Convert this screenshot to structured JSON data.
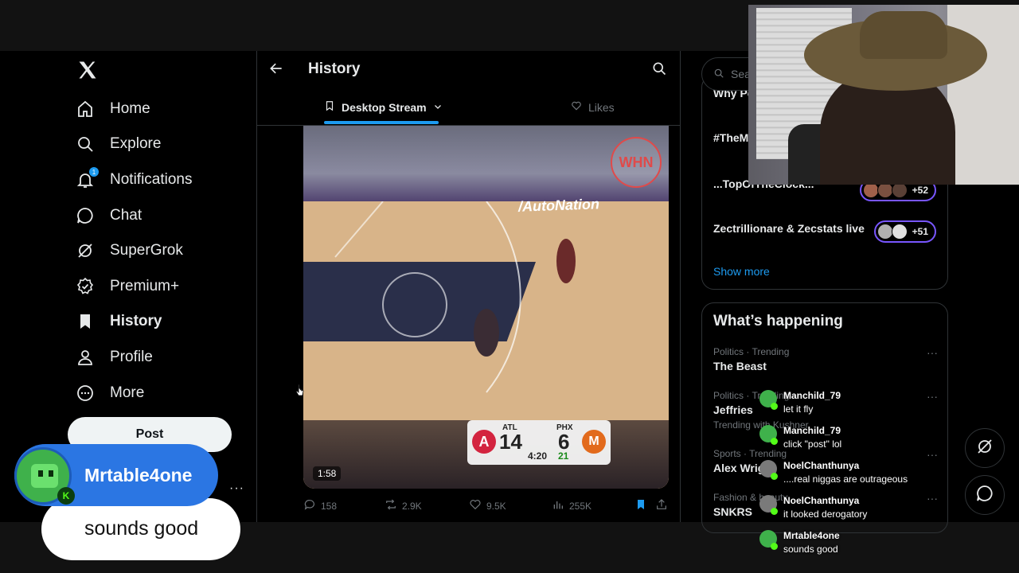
{
  "nav": {
    "items": [
      {
        "label": "Home",
        "icon": "home-icon"
      },
      {
        "label": "Explore",
        "icon": "search-icon"
      },
      {
        "label": "Notifications",
        "icon": "bell-icon",
        "badge": "1"
      },
      {
        "label": "Chat",
        "icon": "chat-bubble-icon"
      },
      {
        "label": "SuperGrok",
        "icon": "grok-icon"
      },
      {
        "label": "Premium+",
        "icon": "verified-icon"
      },
      {
        "label": "History",
        "icon": "bookmark-icon",
        "active": true
      },
      {
        "label": "Profile",
        "icon": "person-icon"
      },
      {
        "label": "More",
        "icon": "more-circle-icon"
      }
    ],
    "post_label": "Post",
    "more_dots": "···"
  },
  "header": {
    "title": "History",
    "tabs": [
      {
        "label": "Desktop Stream",
        "active": true
      },
      {
        "label": "Likes",
        "active": false
      }
    ]
  },
  "video": {
    "duration": "1:58",
    "banner": "/AutoNation",
    "watermark": "WHN",
    "score": {
      "away_team": "ATL",
      "away_score": "14",
      "home_team": "PHX",
      "home_score": "6",
      "clock": "4:20",
      "shot_clock": "21",
      "away_logo": "A",
      "home_logo": "M"
    }
  },
  "actions": {
    "replies": "158",
    "reposts": "2.9K",
    "likes": "9.5K",
    "views": "255K"
  },
  "right": {
    "search_placeholder": "Search",
    "live": [
      {
        "title": "Why People",
        "count": ""
      },
      {
        "title": "#TheM mornin",
        "count": ""
      },
      {
        "title": "...TopOfTheClock...",
        "count": "+52"
      },
      {
        "title": "Zectrillionare & Zecstats live",
        "count": "+51"
      }
    ],
    "show_more": "Show more",
    "happening_title": "What’s happening",
    "trends": [
      {
        "meta": "Politics · Trending",
        "name": "The Beast",
        "sub": ""
      },
      {
        "meta": "Politics · Trending",
        "name": "Jeffries",
        "sub": "Trending with Kushner"
      },
      {
        "meta": "Sports · Trending",
        "name": "Alex Wright",
        "sub": ""
      },
      {
        "meta": "Fashion & beauty",
        "name": "SNKRS",
        "sub": ""
      }
    ]
  },
  "overlay": {
    "username": "Mrtable4one",
    "message": "sounds good",
    "kick_badge": "K",
    "chat": [
      {
        "user": "Manchild_79",
        "msg": "let it fly"
      },
      {
        "user": "Manchild_79",
        "msg": "click \"post\" lol"
      },
      {
        "user": "NoelChanthunya",
        "msg": "....real niggas are outrageous"
      },
      {
        "user": "NoelChanthunya",
        "msg": "it looked derogatory"
      },
      {
        "user": "Mrtable4one",
        "msg": "sounds good"
      }
    ]
  },
  "colors": {
    "accent": "#1d9bf0",
    "background": "#000000",
    "kick_green": "#53fc18",
    "overlay_blue": "#2b76e3"
  }
}
